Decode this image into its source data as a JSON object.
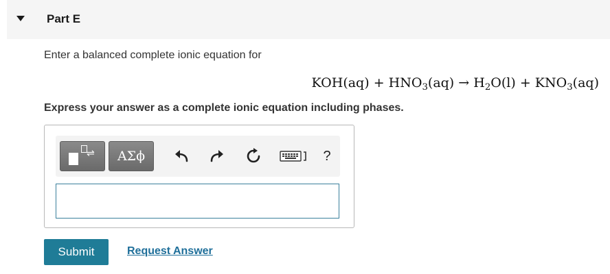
{
  "part": {
    "title": "Part E"
  },
  "question": {
    "prompt": "Enter a balanced complete ionic equation for",
    "equation": {
      "r1": "KOH(aq)",
      "plus1": "+",
      "r2_main": "HNO",
      "r2_sub": "3",
      "r2_phase": "(aq)",
      "arrow": "→",
      "p1_a": "H",
      "p1_sub": "2",
      "p1_b": "O(l)",
      "plus2": "+",
      "p2_main": "KNO",
      "p2_sub": "3",
      "p2_phase": "(aq)"
    },
    "instruction": "Express your answer as a complete ionic equation including phases."
  },
  "toolbar": {
    "symbols_label": "ΑΣϕ",
    "help_label": "?",
    "icons": [
      "templates-icon",
      "undo-icon",
      "redo-icon",
      "reset-icon",
      "keyboard-icon",
      "help-icon"
    ]
  },
  "answer": {
    "value": "",
    "placeholder": ""
  },
  "actions": {
    "submit_label": "Submit",
    "request_answer_label": "Request Answer"
  },
  "colors": {
    "submit_bg": "#1f7c97",
    "link": "#1f6f9a",
    "input_border": "#3a7f9c"
  }
}
